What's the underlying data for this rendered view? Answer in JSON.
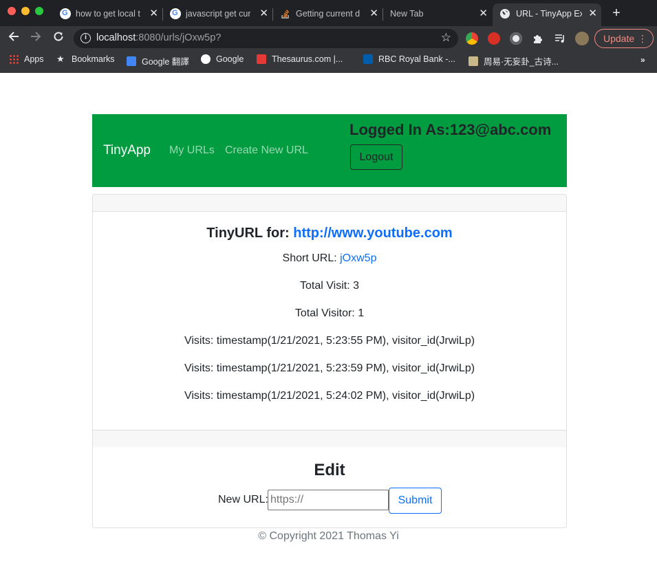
{
  "browser": {
    "tabs": [
      {
        "title": "how to get local t",
        "favicon": "google-icon"
      },
      {
        "title": "javascript get cur",
        "favicon": "google-icon"
      },
      {
        "title": "Getting current d",
        "favicon": "stackoverflow-icon"
      },
      {
        "title": "New Tab",
        "favicon": ""
      },
      {
        "title": "URL - TinyApp Ex",
        "favicon": "globe-icon",
        "active": true
      }
    ],
    "url_host": "localhost",
    "url_path": ":8080/urls/jOxw5p?",
    "update_label": "Update",
    "bookmarks": [
      "Apps",
      "Bookmarks",
      "Google 翻譯",
      "Google",
      "Thesaurus.com |...",
      "RBC Royal Bank -...",
      "周易·无妄卦_古诗..."
    ],
    "bookmarks_more": "»"
  },
  "navbar": {
    "brand": "TinyApp",
    "links": [
      "My URLs",
      "Create New URL"
    ],
    "logged_in": "Logged In As:123@abc.com",
    "logout_label": "Logout"
  },
  "url_card": {
    "title_prefix": "TinyURL for: ",
    "long_url": "http://www.youtube.com",
    "short_url_label": "Short URL: ",
    "short_url": "jOxw5p",
    "total_visit": "Total Visit: 3",
    "total_visitor": "Total Visitor: 1",
    "visits": [
      "Visits: timestamp(1/21/2021, 5:23:55 PM), visitor_id(JrwiLp)",
      "Visits: timestamp(1/21/2021, 5:23:59 PM), visitor_id(JrwiLp)",
      "Visits: timestamp(1/21/2021, 5:24:02 PM), visitor_id(JrwiLp)"
    ]
  },
  "edit": {
    "title": "Edit",
    "label": "New URL:",
    "placeholder": "https://",
    "submit_label": "Submit"
  },
  "footer": {
    "copyright": "© Copyright 2021 Thomas Yi"
  },
  "colors": {
    "navbar_bg": "#009c3f",
    "link": "#0d6efd",
    "chrome_bg": "#35363a",
    "tabstrip_bg": "#202124"
  }
}
